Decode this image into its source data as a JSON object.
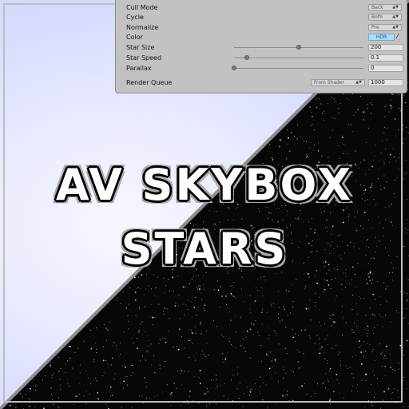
{
  "artwork": {
    "title_line1": "AV SKYBOX",
    "title_line2": "STARS",
    "light_color": "#e9ebff",
    "dark_color": "#070707"
  },
  "inspector": {
    "cull_mode": {
      "label": "Cull Mode",
      "value": "Back"
    },
    "cycle": {
      "label": "Cycle",
      "value": "Both"
    },
    "normalize": {
      "label": "Normalize",
      "value": "Pre"
    },
    "color": {
      "label": "Color",
      "value": "HDR",
      "swatch": "#a9dcf7",
      "picker_icon": "eyedropper-icon"
    },
    "star_size": {
      "label": "Star Size",
      "value": "200",
      "slider_fraction": 0.5
    },
    "star_speed": {
      "label": "Star Speed",
      "value": "0.1",
      "slider_fraction": 0.1
    },
    "parallax": {
      "label": "Parallax",
      "value": "0",
      "slider_fraction": 0.0
    },
    "render_queue": {
      "label": "Render Queue",
      "mode": "From Shader",
      "value": "1000"
    }
  }
}
